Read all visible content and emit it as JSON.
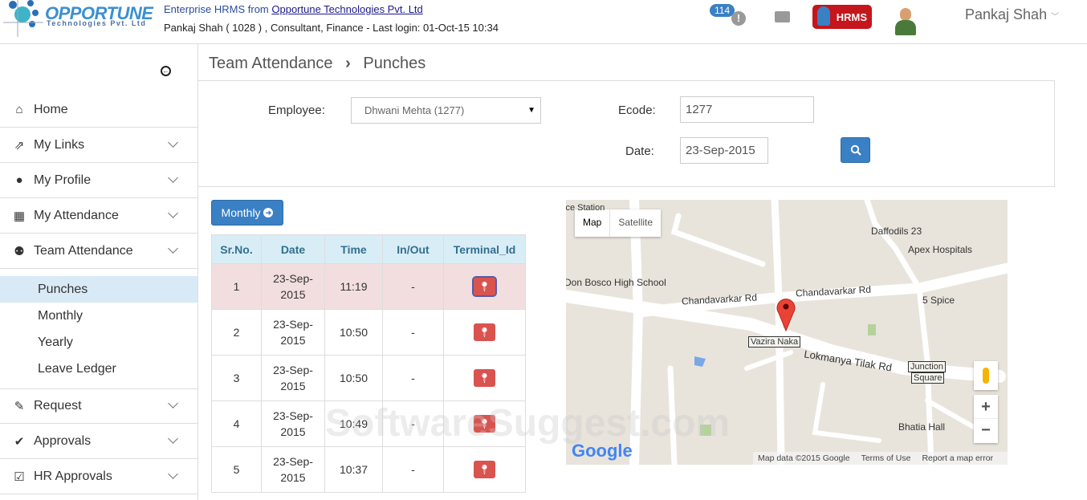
{
  "header": {
    "logo_main": "OPPORTUNE",
    "logo_sub": "Technologies Pvt. Ltd",
    "tagline_prefix": "Enterprise HRMS from ",
    "company_link": "Opportune Technologies Pvt. Ltd",
    "user_info": "Pankaj Shah ( 1028 ) , Consultant, Finance - Last login: 01-Oct-15 10:34",
    "notification_count": "114",
    "hrms_badge": "HRMS",
    "user_name": "Pankaj Shah"
  },
  "sidebar": {
    "items": [
      {
        "label": "Home",
        "icon": "home-icon"
      },
      {
        "label": "My Links",
        "icon": "external-link-icon"
      },
      {
        "label": "My Profile",
        "icon": "user-icon"
      },
      {
        "label": "My Attendance",
        "icon": "calendar-icon"
      },
      {
        "label": "Team Attendance",
        "icon": "users-icon"
      }
    ],
    "sub_items": [
      "Punches",
      "Monthly",
      "Yearly",
      "Leave Ledger"
    ],
    "items_after": [
      {
        "label": "Request",
        "icon": "edit-icon"
      },
      {
        "label": "Approvals",
        "icon": "check-icon"
      },
      {
        "label": "HR Approvals",
        "icon": "check-square-icon"
      }
    ]
  },
  "breadcrumb": {
    "parent": "Team Attendance",
    "current": "Punches"
  },
  "filters": {
    "employee_label": "Employee:",
    "employee_value": "Dhwani Mehta (1277)",
    "ecode_label": "Ecode:",
    "ecode_value": "1277",
    "date_label": "Date:",
    "date_value": "23-Sep-2015"
  },
  "monthly_button": "Monthly",
  "table": {
    "columns": [
      "Sr.No.",
      "Date",
      "Time",
      "In/Out",
      "Terminal_Id"
    ],
    "rows": [
      {
        "sr": "1",
        "date1": "23-Sep-",
        "date2": "2015",
        "time": "11:19",
        "inout": "-"
      },
      {
        "sr": "2",
        "date1": "23-Sep-",
        "date2": "2015",
        "time": "10:50",
        "inout": "-"
      },
      {
        "sr": "3",
        "date1": "23-Sep-",
        "date2": "2015",
        "time": "10:50",
        "inout": "-"
      },
      {
        "sr": "4",
        "date1": "23-Sep-",
        "date2": "2015",
        "time": "10:49",
        "inout": "-"
      },
      {
        "sr": "5",
        "date1": "23-Sep-",
        "date2": "2015",
        "time": "10:37",
        "inout": "-"
      }
    ]
  },
  "map": {
    "tab_map": "Map",
    "tab_satellite": "Satellite",
    "labels": {
      "station": "ice Station",
      "daffodils": "Daffodils 23",
      "apex": "Apex Hospitals",
      "don_bosco": "Don Bosco High School",
      "chandavarkar1": "Chandavarkar Rd",
      "chandavarkar2": "Chandavarkar Rd",
      "spice": "5 Spice",
      "vazira": "Vazira Naka",
      "lokmanya": "Lokmanya Tilak Rd",
      "junction1": "Junction",
      "junction2": "Square",
      "bhatia": "Bhatia Hall"
    },
    "google": "Google",
    "map_data": "Map data ©2015 Google",
    "terms": "Terms of Use",
    "report": "Report a map error",
    "zoom_in": "+",
    "zoom_out": "−"
  },
  "watermark": "SoftwareSuggest.com"
}
